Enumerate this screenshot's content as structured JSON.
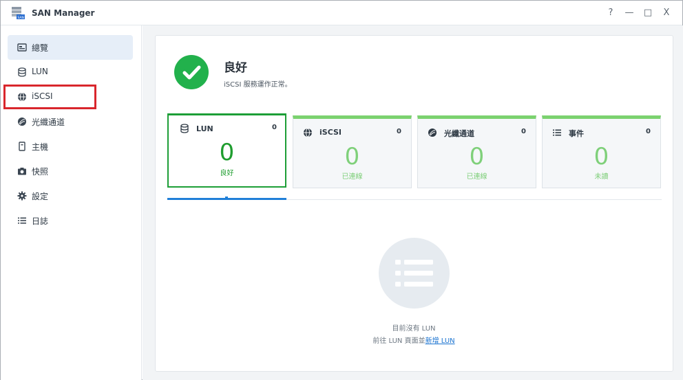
{
  "window": {
    "title": "SAN Manager",
    "controls": {
      "help": "?",
      "minimize": "—",
      "maximize": "□",
      "close": "X"
    }
  },
  "sidebar": {
    "items": [
      {
        "label": "總覽",
        "icon": "overview-icon",
        "active": true
      },
      {
        "label": "LUN",
        "icon": "lun-icon",
        "active": false
      },
      {
        "label": "iSCSI",
        "icon": "globe-icon",
        "active": false
      },
      {
        "label": "光纖通道",
        "icon": "fibre-channel-icon",
        "active": false
      },
      {
        "label": "主機",
        "icon": "host-icon",
        "active": false
      },
      {
        "label": "快照",
        "icon": "camera-icon",
        "active": false
      },
      {
        "label": "設定",
        "icon": "gear-icon",
        "active": false
      },
      {
        "label": "日誌",
        "icon": "list-icon",
        "active": false
      }
    ]
  },
  "status": {
    "title": "良好",
    "subtitle": "iSCSI 服務運作正常。"
  },
  "cards": [
    {
      "label": "LUN",
      "count": "0",
      "big": "0",
      "status": "良好",
      "icon": "lun-icon"
    },
    {
      "label": "iSCSI",
      "count": "0",
      "big": "0",
      "status": "已連線",
      "icon": "globe-icon"
    },
    {
      "label": "光纖通道",
      "count": "0",
      "big": "0",
      "status": "已連線",
      "icon": "fibre-channel-icon"
    },
    {
      "label": "事件",
      "count": "0",
      "big": "0",
      "status": "未讀",
      "icon": "list-icon"
    }
  ],
  "empty": {
    "line1": "目前沒有 LUN",
    "line2_prefix": "前往 LUN 頁面並",
    "line2_link": "新增 LUN"
  },
  "colors": {
    "accent_blue": "#1f7fd8",
    "status_green": "#22b14c",
    "highlight_red": "#d9262c"
  }
}
